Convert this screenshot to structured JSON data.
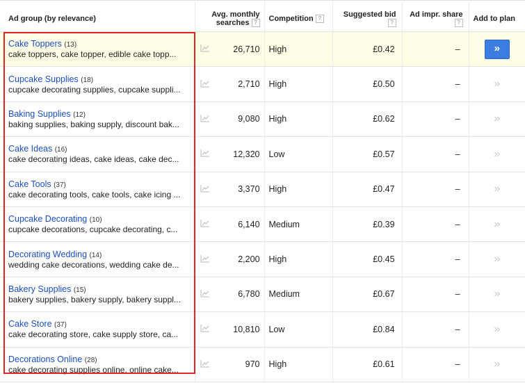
{
  "header": {
    "ad_group": "Ad group (by relevance)",
    "searches_line1": "Avg. monthly",
    "searches_line2": "searches",
    "competition": "Competition",
    "bid": "Suggested bid",
    "share": "Ad impr. share",
    "add": "Add to plan",
    "help": "?"
  },
  "colors": {
    "link": "#1a4fba",
    "highlight_row": "#fdfde6",
    "add_button": "#3b7de0",
    "selection_box": "#e02424"
  },
  "rows": [
    {
      "name": "Cake Toppers",
      "count": "(13)",
      "keywords": "cake toppers, cake topper, edible cake topp...",
      "searches": "26,710",
      "competition": "High",
      "bid": "£0.42",
      "share": "–",
      "add": "»"
    },
    {
      "name": "Cupcake Supplies",
      "count": "(18)",
      "keywords": "cupcake decorating supplies, cupcake suppli...",
      "searches": "2,710",
      "competition": "High",
      "bid": "£0.50",
      "share": "–",
      "add": "»"
    },
    {
      "name": "Baking Supplies",
      "count": "(12)",
      "keywords": "baking supplies, baking supply, discount bak...",
      "searches": "9,080",
      "competition": "High",
      "bid": "£0.62",
      "share": "–",
      "add": "»"
    },
    {
      "name": "Cake Ideas",
      "count": "(16)",
      "keywords": "cake decorating ideas, cake ideas, cake dec...",
      "searches": "12,320",
      "competition": "Low",
      "bid": "£0.57",
      "share": "–",
      "add": "»"
    },
    {
      "name": "Cake Tools",
      "count": "(37)",
      "keywords": "cake decorating tools, cake tools, cake icing ...",
      "searches": "3,370",
      "competition": "High",
      "bid": "£0.47",
      "share": "–",
      "add": "»"
    },
    {
      "name": "Cupcake Decorating",
      "count": "(10)",
      "keywords": "cupcake decorations, cupcake decorating, c...",
      "searches": "6,140",
      "competition": "Medium",
      "bid": "£0.39",
      "share": "–",
      "add": "»"
    },
    {
      "name": "Decorating Wedding",
      "count": "(14)",
      "keywords": "wedding cake decorations, wedding cake de...",
      "searches": "2,200",
      "competition": "High",
      "bid": "£0.45",
      "share": "–",
      "add": "»"
    },
    {
      "name": "Bakery Supplies",
      "count": "(15)",
      "keywords": "bakery supplies, bakery supply, bakery suppl...",
      "searches": "6,780",
      "competition": "Medium",
      "bid": "£0.67",
      "share": "–",
      "add": "»"
    },
    {
      "name": "Cake Store",
      "count": "(37)",
      "keywords": "cake decorating store, cake supply store, ca...",
      "searches": "10,810",
      "competition": "Low",
      "bid": "£0.84",
      "share": "–",
      "add": "»"
    },
    {
      "name": "Decorations Online",
      "count": "(28)",
      "keywords": "cake decorating supplies online, online cake...",
      "searches": "970",
      "competition": "High",
      "bid": "£0.61",
      "share": "–",
      "add": "»"
    }
  ]
}
